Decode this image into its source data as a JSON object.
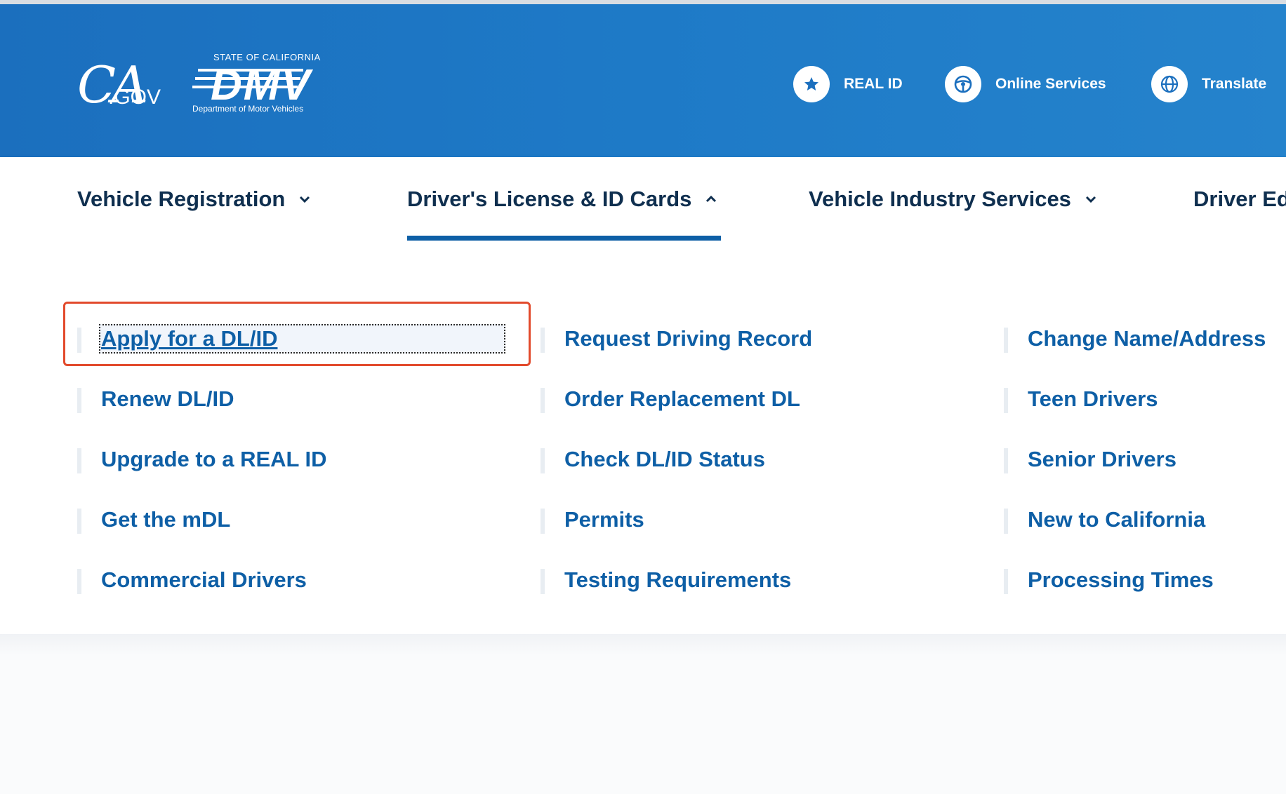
{
  "header": {
    "ca_logo": {
      "mark": "CA",
      "suffix": ".GOV"
    },
    "dmv_logo": {
      "state_text": "STATE OF CALIFORNIA",
      "mark": "DMV",
      "dept_text": "Department of Motor Vehicles"
    },
    "utility_links": [
      {
        "label": "REAL ID",
        "icon": "star-icon"
      },
      {
        "label": "Online Services",
        "icon": "steering-wheel-icon"
      },
      {
        "label": "Translate",
        "icon": "globe-icon"
      }
    ],
    "colors": {
      "brand_blue": "#1e7ac7",
      "white": "#ffffff"
    }
  },
  "nav": {
    "items": [
      {
        "label": "Vehicle Registration",
        "expanded": false
      },
      {
        "label": "Driver's License & ID Cards",
        "expanded": true
      },
      {
        "label": "Vehicle Industry Services",
        "expanded": false
      },
      {
        "label": "Driver Ed",
        "expanded": false
      }
    ],
    "colors": {
      "text": "#0f2f4f",
      "active_underline": "#0e5fa6"
    }
  },
  "dropdown": {
    "columns": [
      [
        "Apply for a DL/ID",
        "Renew DL/ID",
        "Upgrade to a REAL ID",
        "Get the mDL",
        "Commercial Drivers"
      ],
      [
        "Request Driving Record",
        "Order Replacement DL",
        "Check DL/ID Status",
        "Permits",
        "Testing Requirements"
      ],
      [
        "Change Name/Address",
        "Teen Drivers",
        "Senior Drivers",
        "New to California",
        "Processing Times"
      ]
    ],
    "focused_item": "Apply for a DL/ID",
    "colors": {
      "link": "#0e5fa6",
      "highlight_border": "#e24a2c"
    }
  }
}
